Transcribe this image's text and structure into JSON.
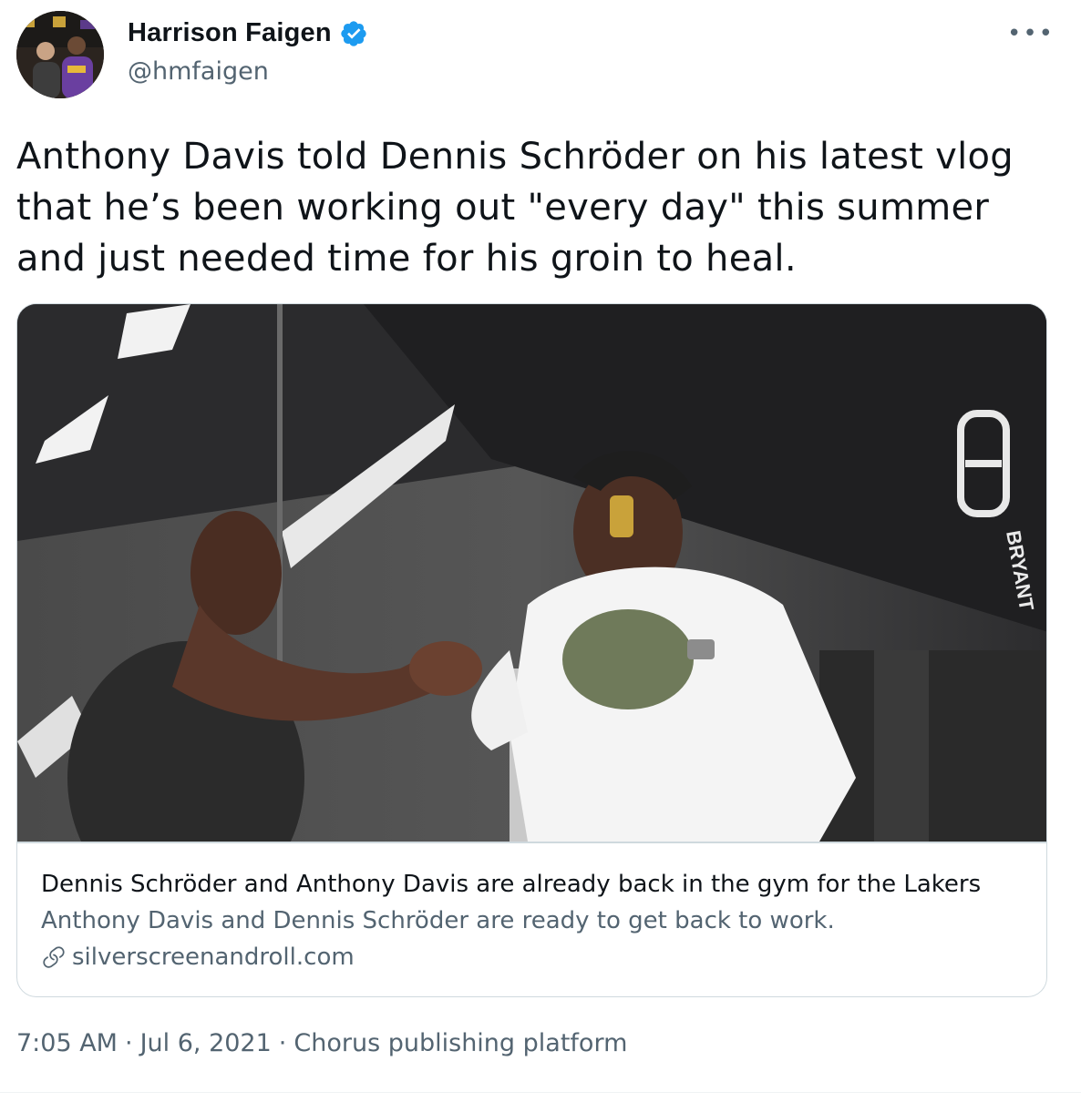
{
  "author": {
    "name": "Harrison Faigen",
    "handle": "@hmfaigen",
    "verified": true,
    "avatar_icon": "profile-photo"
  },
  "tweet": {
    "text": "Anthony Davis told Dennis Schröder on his latest vlog that he’s been working out \"every day\" this summer and just needed time for his groin to heal."
  },
  "card": {
    "image_text": "BRYANT",
    "title": "Dennis Schröder and Anthony Davis are already back in the gym for the Lakers",
    "description": "Anthony Davis and Dennis Schröder are ready to get back to work.",
    "domain": "silverscreenandroll.com"
  },
  "meta": {
    "time": "7:05 AM",
    "sep1": "·",
    "date": "Jul 6, 2021",
    "sep2": "·",
    "source": "Chorus publishing platform"
  },
  "colors": {
    "verified": "#1d9bf0",
    "secondary_text": "#536471",
    "border": "#cfd9de"
  }
}
